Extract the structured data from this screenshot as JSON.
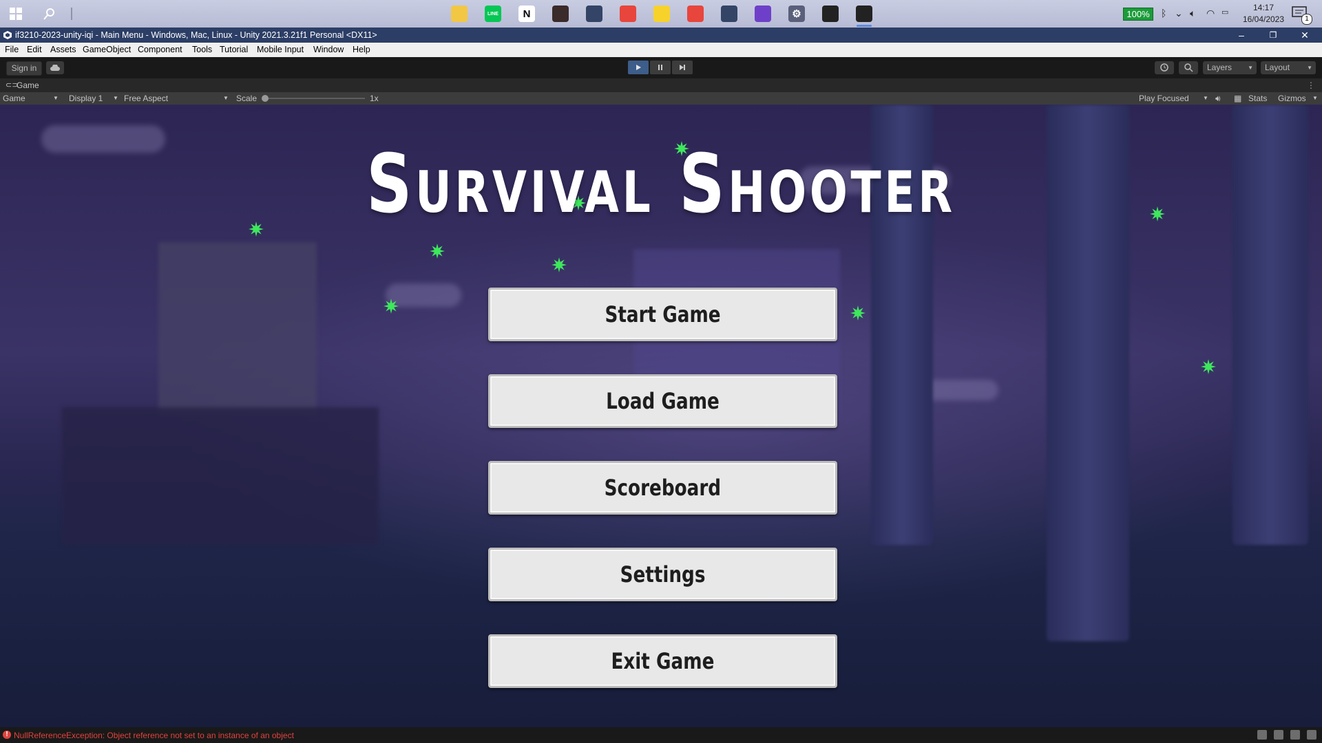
{
  "taskbar": {
    "battery": "100%",
    "time": "14:17",
    "date": "16/04/2023",
    "notification_count": "1",
    "apps": [
      {
        "name": "file-explorer-icon",
        "color": "#f2c744",
        "glyph": ""
      },
      {
        "name": "line-app-icon",
        "color": "#06c755",
        "glyph": "LINE"
      },
      {
        "name": "notion-icon",
        "color": "#ffffff",
        "glyph": "N"
      },
      {
        "name": "game-character-icon",
        "color": "#3a2a2a",
        "glyph": ""
      },
      {
        "name": "game-app-icon",
        "color": "#334466",
        "glyph": ""
      },
      {
        "name": "chrome-icon",
        "color": "#e8453c",
        "glyph": ""
      },
      {
        "name": "sticky-notes-icon",
        "color": "#f7d22b",
        "glyph": ""
      },
      {
        "name": "chrome-profile-icon",
        "color": "#e8453c",
        "glyph": ""
      },
      {
        "name": "game-app-2-icon",
        "color": "#334466",
        "glyph": ""
      },
      {
        "name": "github-desktop-icon",
        "color": "#6e40c9",
        "glyph": ""
      },
      {
        "name": "settings-icon",
        "color": "#5a5f7a",
        "glyph": "⚙"
      },
      {
        "name": "unity-hub-icon",
        "color": "#222222",
        "glyph": ""
      },
      {
        "name": "unity-editor-icon",
        "color": "#222222",
        "glyph": ""
      }
    ]
  },
  "window": {
    "title": "if3210-2023-unity-iqi - Main Menu - Windows, Mac, Linux - Unity 2021.3.21f1 Personal <DX11>"
  },
  "menu": [
    "File",
    "Edit",
    "Assets",
    "GameObject",
    "Component",
    "Tools",
    "Tutorial",
    "Mobile Input",
    "Window",
    "Help"
  ],
  "toolbar": {
    "sign_in": "Sign in",
    "layers": "Layers",
    "layout": "Layout"
  },
  "game_tab": {
    "label": "Game",
    "mode": "Game",
    "display": "Display 1",
    "aspect": "Free Aspect",
    "scale_label": "Scale",
    "scale_value": "1x",
    "play_focused": "Play Focused",
    "stats": "Stats",
    "gizmos": "Gizmos"
  },
  "game": {
    "title": "Survival Shooter",
    "buttons": [
      "Start Game",
      "Load Game",
      "Scoreboard",
      "Settings",
      "Exit Game"
    ],
    "colors": {
      "star": "#3ee85c",
      "button": "#e8e8e8"
    }
  },
  "status": {
    "error": "NullReferenceException: Object reference not set to an instance of an object"
  }
}
